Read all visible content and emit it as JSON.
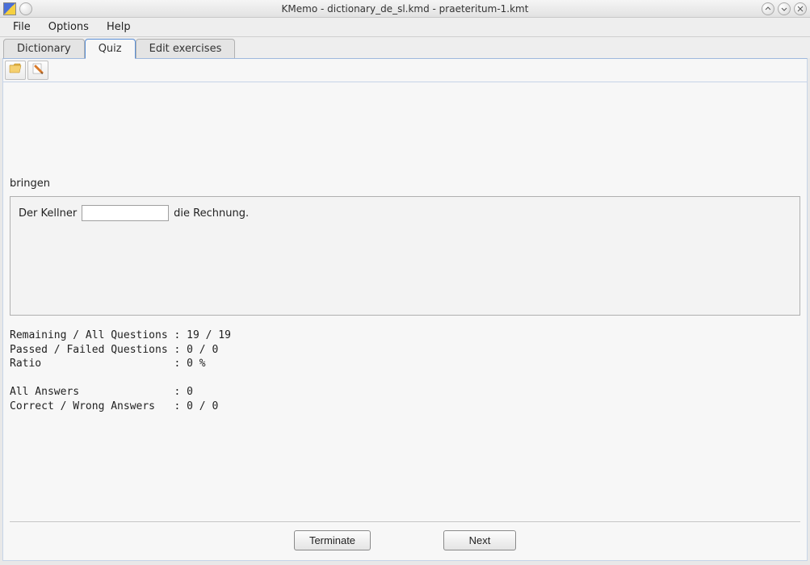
{
  "titlebar": {
    "title": "KMemo - dictionary_de_sl.kmd - praeteritum-1.kmt"
  },
  "menu": {
    "file": "File",
    "options": "Options",
    "help": "Help"
  },
  "tabs": {
    "dictionary": "Dictionary",
    "quiz": "Quiz",
    "edit": "Edit exercises",
    "active": "quiz"
  },
  "toolbar_icons": {
    "open": "open-folder-icon",
    "edit": "edit-pencil-icon"
  },
  "quiz": {
    "prompt": "bringen",
    "sentence_before": "Der Kellner",
    "sentence_after": "die Rechnung.",
    "answer_value": ""
  },
  "stats": {
    "line1": "Remaining / All Questions : 19 / 19",
    "line2": "Passed / Failed Questions : 0 / 0",
    "line3": "Ratio                     : 0 %",
    "line4": "",
    "line5": "All Answers               : 0",
    "line6": "Correct / Wrong Answers   : 0 / 0"
  },
  "buttons": {
    "terminate": "Terminate",
    "next": "Next"
  }
}
